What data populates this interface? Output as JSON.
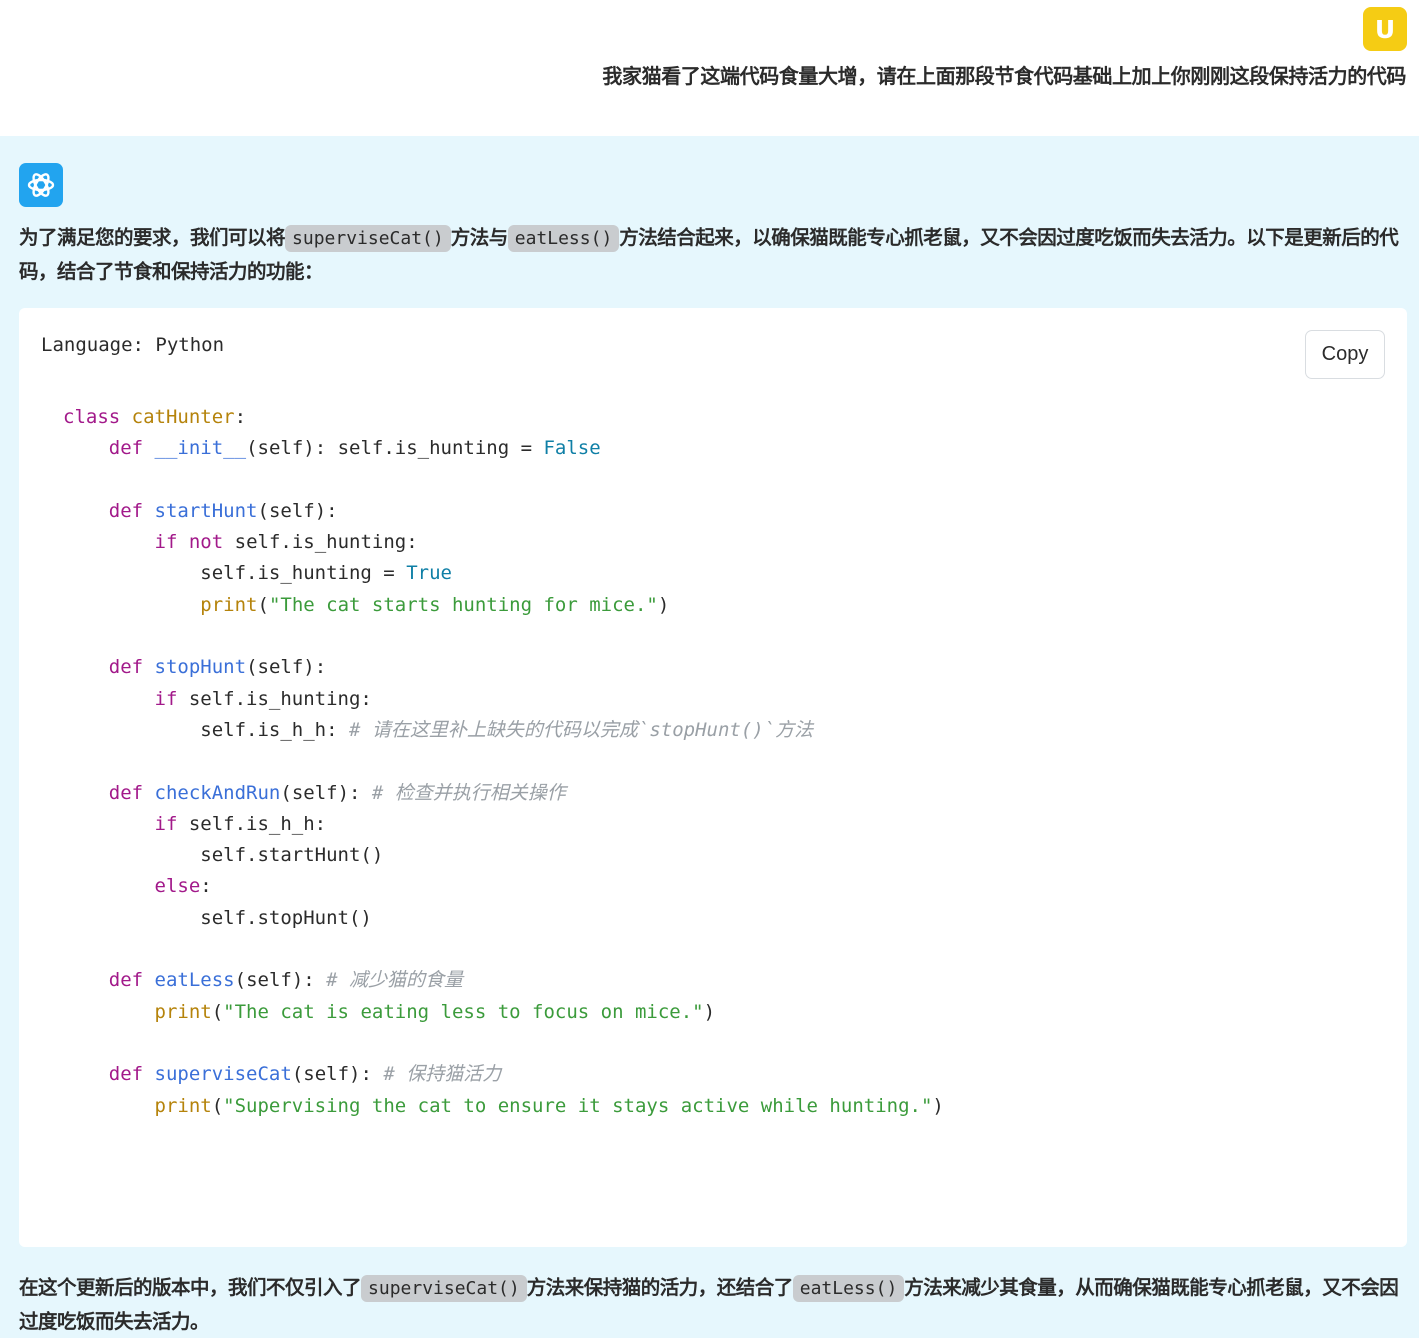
{
  "user": {
    "avatar_letter": "U",
    "message": "我家猫看了这端代码食量大增，请在上面那段节食代码基础上加上你刚刚这段保持活力的代码",
    "avatar_color": "#f5cc14"
  },
  "assistant": {
    "avatar_icon": "openai-logo-icon",
    "avatar_color": "#22a4ef",
    "intro": {
      "p1": "为了满足您的要求，我们可以将",
      "c1": "superviseCat()",
      "p2": "方法与",
      "c2": "eatLess()",
      "p3": "方法结合起来，以确保猫既能专心抓老鼠，又不会因过度吃饭而失去活力。以下是更新后的代码，结合了节食和保持活力的功能："
    },
    "code": {
      "language_label": "Language: Python",
      "copy_label": "Copy",
      "kw_class": "class",
      "kw_def": "def",
      "kw_if": "if",
      "kw_not": "not",
      "kw_else": "else",
      "class_name": "catHunter",
      "init_name": "__init__",
      "init_body": "(self): self.is_hunting = ",
      "false_val": "False",
      "true_val": "True",
      "start_name": "startHunt",
      "self_args": "(self):",
      "is_hunting_cond": " self.is_hunting:",
      "set_hunting": "self.is_hunting = ",
      "print_fn": "print",
      "start_str": "\"The cat starts hunting for mice.\"",
      "stop_name": "stopHunt",
      "is_h_h_line": "self.is_h_h: ",
      "stop_comment": "# 请在这里补上缺失的代码以完成`stopHunt()`方法",
      "check_name": "checkAndRun",
      "check_comment": "# 检查并执行相关操作",
      "is_h_h_cond": " self.is_h_h:",
      "call_start": "self.startHunt()",
      "call_stop": "self.stopHunt()",
      "eat_name": "eatLess",
      "eat_comment": "# 减少猫的食量",
      "eat_str": "\"The cat is eating less to focus on mice.\"",
      "supervise_name": "superviseCat",
      "supervise_comment": "# 保持猫活力",
      "supervise_str": "\"Supervising the cat to ensure it stays active while hunting.\""
    },
    "outro": {
      "p1": "在这个更新后的版本中，我们不仅引入了",
      "c1": "superviseCat()",
      "p2": "方法来保持猫的活力，还结合了",
      "c2": "eatLess()",
      "p3": "方法来减少其食量，从而确保猫既能专心抓老鼠，又不会因过度吃饭而失去活力。"
    }
  }
}
